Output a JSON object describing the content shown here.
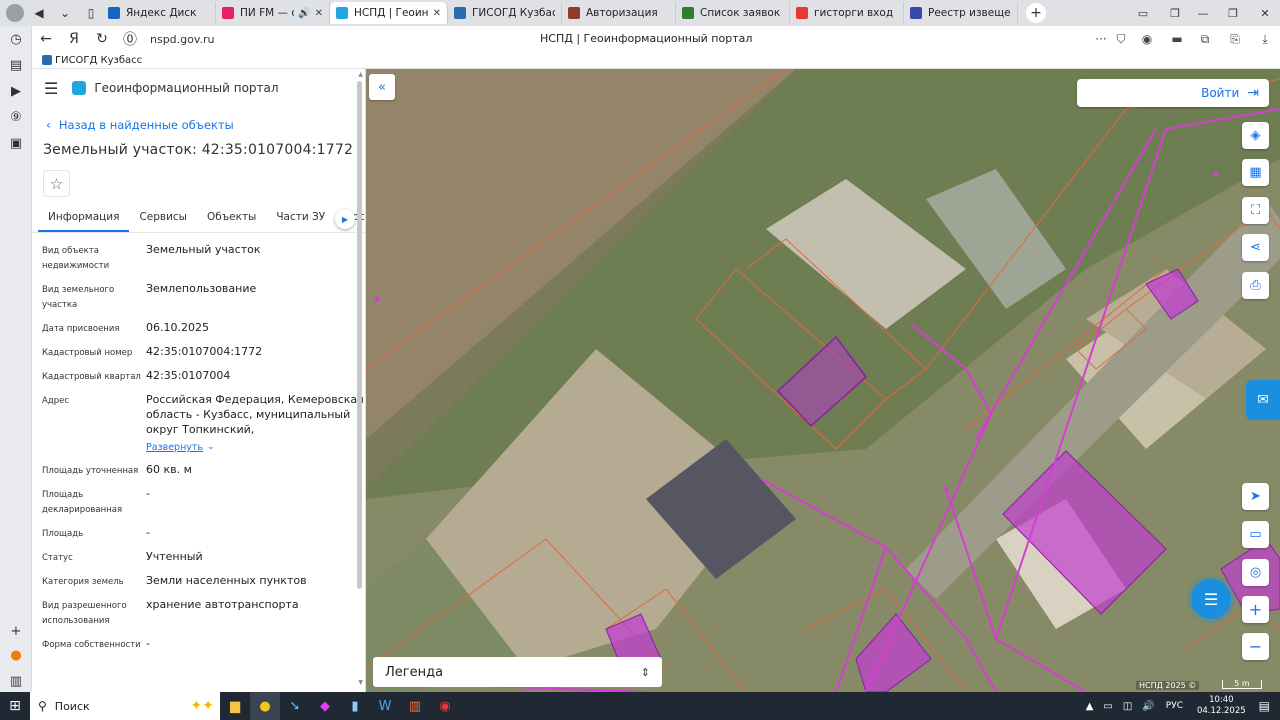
{
  "browser": {
    "tabs": [
      {
        "label": "Яндекс Диск",
        "color": "#1565c0"
      },
      {
        "label": "ПИ FM — слуша",
        "color": "#e91e63",
        "audio": "🔊"
      },
      {
        "label": "НСПД | Геоинфор",
        "color": "#1ea7e1",
        "active": true
      },
      {
        "label": "ГИСОГД Кузбасса",
        "color": "#2b6cb0"
      },
      {
        "label": "Авторизация",
        "color": "#8d3b2b"
      },
      {
        "label": "Список заявок — Тех",
        "color": "#2e7d32"
      },
      {
        "label": "гисторги вход в личн",
        "color": "#e53935"
      },
      {
        "label": "Реестр извещений",
        "color": "#3949ab"
      }
    ],
    "url": "nspd.gov.ru",
    "page_title": "НСПД | Геоинформационный портал",
    "bookmark": "ГИСОГД Кузбасс"
  },
  "panel": {
    "portal_title": "Геоинформационный портал",
    "back_link": "Назад в найденные объекты",
    "object_title": "Земельный участок: 42:35:0107004:1772",
    "tabs": [
      "Информация",
      "Сервисы",
      "Объекты",
      "Части ЗУ",
      "Соста"
    ],
    "properties": [
      {
        "key": "Вид объекта недвижимости",
        "value": "Земельный участок"
      },
      {
        "key": "Вид земельного участка",
        "value": "Землепользование"
      },
      {
        "key": "Дата присвоения",
        "value": "06.10.2025"
      },
      {
        "key": "Кадастровый номер",
        "value": "42:35:0107004:1772"
      },
      {
        "key": "Кадастровый квартал",
        "value": "42:35:0107004"
      },
      {
        "key": "Адрес",
        "value": "Российская Федерация, Кемеровская область - Кузбасс, муниципальный округ Топкинский,"
      },
      {
        "key": "Площадь уточненная",
        "value": "60 кв. м"
      },
      {
        "key": "Площадь декларированная",
        "value": "-"
      },
      {
        "key": "Площадь",
        "value": "-"
      },
      {
        "key": "Статус",
        "value": "Учтенный"
      },
      {
        "key": "Категория земель",
        "value": "Земли населенных пунктов"
      },
      {
        "key": "Вид разрешенного использования",
        "value": "хранение автотранспорта"
      },
      {
        "key": "Форма собственности",
        "value": "-"
      }
    ],
    "expand_link": "Развернуть"
  },
  "map": {
    "login_label": "Войти",
    "legend_label": "Легенда",
    "copyright": "НСПД 2025 ©",
    "scale_label": "5 m",
    "colors": {
      "parcel_line": "#e8663a",
      "selected_fill": "#b03cc8",
      "road": "#d63dd3"
    }
  },
  "taskbar": {
    "search_label": "Поиск",
    "lang": "РУС",
    "time": "10:40",
    "date": "04.12.2025"
  }
}
